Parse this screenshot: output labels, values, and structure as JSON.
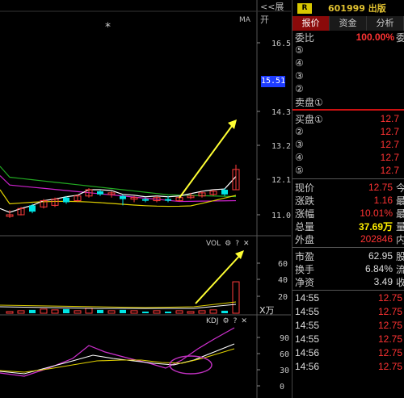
{
  "chart": {
    "expand_label": "<<展开",
    "ma_label": "MA",
    "asterisk": "*",
    "current_price_flag": "15.51",
    "price_ticks": [
      "16.5",
      "14.3",
      "13.2",
      "12.1",
      "11.0"
    ],
    "vol_panel": {
      "title": "VOL",
      "ticks": [
        "60",
        "40",
        "20"
      ],
      "unit": "X万"
    },
    "kdj_panel": {
      "title": "KDJ",
      "ticks": [
        "90",
        "60",
        "30",
        "0"
      ]
    },
    "icons": {
      "gear": "⚙",
      "help": "?",
      "close": "✕"
    },
    "colors": {
      "up": "#ff3b3b",
      "down": "#00e5e5",
      "annotation": "#ffff33",
      "ma_long": "#22aa22",
      "ma_mid": "#cc22cc",
      "ma_short": "#ffffff",
      "ma_yellow": "#e0d000"
    }
  },
  "chart_data": {
    "type": "candlestick",
    "candles": [
      {
        "o": 10.95,
        "h": 11.15,
        "l": 10.9,
        "c": 11.0,
        "dir": "up"
      },
      {
        "o": 11.0,
        "h": 11.25,
        "l": 10.98,
        "c": 11.2,
        "dir": "up"
      },
      {
        "o": 11.3,
        "h": 11.35,
        "l": 11.05,
        "c": 11.1,
        "dir": "down"
      },
      {
        "o": 11.25,
        "h": 11.5,
        "l": 11.2,
        "c": 11.45,
        "dir": "up"
      },
      {
        "o": 11.3,
        "h": 11.55,
        "l": 11.25,
        "c": 11.5,
        "dir": "up"
      },
      {
        "o": 11.55,
        "h": 11.6,
        "l": 11.35,
        "c": 11.4,
        "dir": "down"
      },
      {
        "o": 11.45,
        "h": 11.65,
        "l": 11.4,
        "c": 11.6,
        "dir": "up"
      },
      {
        "o": 11.6,
        "h": 11.85,
        "l": 11.55,
        "c": 11.8,
        "dir": "up"
      },
      {
        "o": 11.75,
        "h": 11.8,
        "l": 11.6,
        "c": 11.65,
        "dir": "down"
      },
      {
        "o": 11.65,
        "h": 11.75,
        "l": 11.55,
        "c": 11.7,
        "dir": "up"
      },
      {
        "o": 11.6,
        "h": 11.65,
        "l": 11.3,
        "c": 11.5,
        "dir": "down"
      },
      {
        "o": 11.55,
        "h": 11.6,
        "l": 11.4,
        "c": 11.5,
        "dir": "up"
      },
      {
        "o": 11.5,
        "h": 11.55,
        "l": 11.4,
        "c": 11.45,
        "dir": "down"
      },
      {
        "o": 11.45,
        "h": 11.6,
        "l": 11.4,
        "c": 11.55,
        "dir": "up"
      },
      {
        "o": 11.5,
        "h": 11.6,
        "l": 11.4,
        "c": 11.45,
        "dir": "down"
      },
      {
        "o": 11.45,
        "h": 11.6,
        "l": 11.42,
        "c": 11.55,
        "dir": "up"
      },
      {
        "o": 11.55,
        "h": 11.7,
        "l": 11.5,
        "c": 11.6,
        "dir": "up"
      },
      {
        "o": 11.6,
        "h": 11.75,
        "l": 11.55,
        "c": 11.7,
        "dir": "up"
      },
      {
        "o": 11.65,
        "h": 11.8,
        "l": 11.6,
        "c": 11.75,
        "dir": "up"
      },
      {
        "o": 11.8,
        "h": 11.85,
        "l": 11.6,
        "c": 11.65,
        "dir": "down"
      },
      {
        "o": 11.8,
        "h": 12.6,
        "l": 11.8,
        "c": 12.45,
        "dir": "up"
      }
    ],
    "volume": [
      2,
      3,
      4,
      5,
      4,
      5,
      3,
      6,
      4,
      3,
      4,
      3,
      2,
      3,
      2,
      3,
      2,
      3,
      4,
      3,
      37.69
    ],
    "annotation": "arrows indicating upward breakout"
  },
  "quote": {
    "badge": "R",
    "stock": "601999 出版",
    "tabs": [
      "报价",
      "资金",
      "分析"
    ],
    "weibi_label": "委比",
    "weibi_value": "100.00%",
    "weibi_suffix": "委",
    "sell": [
      {
        "label": "⑤",
        "value": ""
      },
      {
        "label": "④",
        "value": ""
      },
      {
        "label": "③",
        "value": ""
      },
      {
        "label": "②",
        "value": ""
      },
      {
        "label": "卖盘①",
        "value": ""
      }
    ],
    "buy": [
      {
        "label": "买盘①",
        "value": "12.7"
      },
      {
        "label": "②",
        "value": "12.7"
      },
      {
        "label": "③",
        "value": "12.7"
      },
      {
        "label": "④",
        "value": "12.7"
      },
      {
        "label": "⑤",
        "value": "12.7"
      }
    ],
    "stats": [
      {
        "label": "现价",
        "value": "12.75",
        "suffix": "今",
        "style": "red"
      },
      {
        "label": "涨跌",
        "value": "1.16",
        "suffix": "最",
        "style": "red"
      },
      {
        "label": "涨幅",
        "value": "10.01%",
        "suffix": "最",
        "style": "red"
      },
      {
        "label": "总量",
        "value": "37.69万",
        "suffix": "量",
        "style": "yellow"
      },
      {
        "label": "外盘",
        "value": "202846",
        "suffix": "内",
        "style": "red"
      }
    ],
    "stats2": [
      {
        "label": "市盈",
        "value": "62.95",
        "suffix": "股",
        "style": "white"
      },
      {
        "label": "换手",
        "value": "6.84%",
        "suffix": "流",
        "style": "white"
      },
      {
        "label": "净资",
        "value": "3.49",
        "suffix": "收",
        "style": "white"
      }
    ],
    "ticks": [
      {
        "time": "14:55",
        "price": "12.75"
      },
      {
        "time": "14:55",
        "price": "12.75"
      },
      {
        "time": "14:55",
        "price": "12.75"
      },
      {
        "time": "14:55",
        "price": "12.75"
      },
      {
        "time": "14:56",
        "price": "12.75"
      },
      {
        "time": "14:56",
        "price": "12.75"
      }
    ]
  }
}
